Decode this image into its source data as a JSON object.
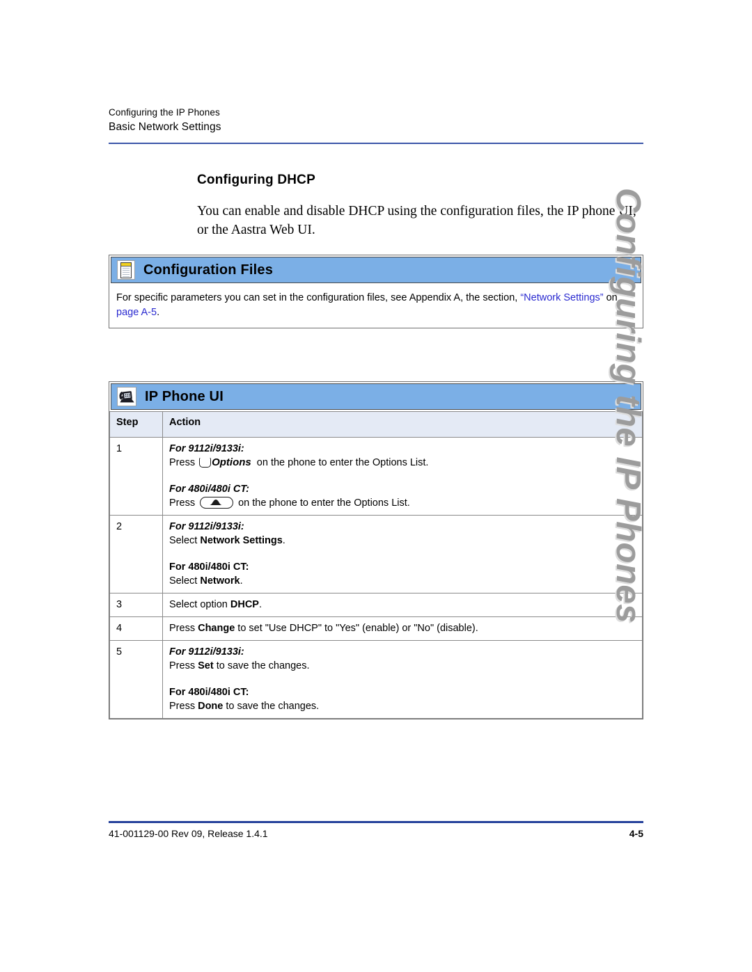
{
  "page": {
    "running_head_line1": "Configuring the IP Phones",
    "running_head_line2": "Basic Network Settings",
    "section_heading": "Configuring DHCP",
    "intro_paragraph": "You can enable and disable DHCP using the configuration files, the IP phone UI, or the Aastra Web UI.",
    "side_tab_text": "Configuring the IP Phones",
    "footer_left": "41-001129-00 Rev 09, Release 1.4.1",
    "footer_page": "4-5",
    "rule_color": "#3b55a8",
    "footer_rule_color": "#24409a",
    "side_tab_color": "#9c9c9c"
  },
  "config_files_box": {
    "icon": "notepad-icon",
    "title": "Configuration Files",
    "header_bg": "#7bafe6",
    "body_text_pre": "For specific parameters you can set in the configuration files, see Appendix A, the section, ",
    "link_open_quote": "“Network Settings”",
    "body_text_mid": " on ",
    "link_page": "page A-5",
    "body_text_end": ".",
    "link_color": "#2a2ad0"
  },
  "ip_phone_box": {
    "icon": "desk-phone-icon",
    "title": "IP Phone UI",
    "header_bg": "#7bafe6",
    "table": {
      "header_bg": "#e4eaf5",
      "columns": [
        "Step",
        "Action"
      ],
      "rows": [
        {
          "step": "1",
          "blocks": [
            {
              "label": "For 9112i/9133i:",
              "label_style": "bold-italic",
              "text_before_key": "Press ",
              "key": "options-key",
              "key_label": "Options",
              "text_after_key": " on the phone to enter the Options List."
            },
            {
              "label": "For 480i/480i CT:",
              "label_style": "bold-italic",
              "text_before_key": "Press ",
              "key": "oval-arrow-key",
              "key_label": "",
              "text_after_key": " on the phone to enter the Options List."
            }
          ]
        },
        {
          "step": "2",
          "blocks": [
            {
              "label": "For 9112i/9133i:",
              "label_style": "bold-italic",
              "text_before_key": "Select ",
              "key": "",
              "key_label": "Network Settings",
              "text_after_key": "."
            },
            {
              "label": "For 480i/480i CT:",
              "label_style": "bold",
              "text_before_key": "Select ",
              "key": "",
              "key_label": "Network",
              "text_after_key": "."
            }
          ]
        },
        {
          "step": "3",
          "blocks": [
            {
              "label": "",
              "label_style": "",
              "text_before_key": "Select option ",
              "key": "",
              "key_label": "DHCP",
              "text_after_key": "."
            }
          ]
        },
        {
          "step": "4",
          "blocks": [
            {
              "label": "",
              "label_style": "",
              "text_before_key": "Press ",
              "key": "",
              "key_label": "Change",
              "text_after_key": " to set \"Use DHCP\" to \"Yes\" (enable) or \"No\" (disable)."
            }
          ]
        },
        {
          "step": "5",
          "blocks": [
            {
              "label": "For 9112i/9133i:",
              "label_style": "bold-italic",
              "text_before_key": "Press ",
              "key": "",
              "key_label": "Set",
              "text_after_key": " to save the changes."
            },
            {
              "label": "For 480i/480i CT:",
              "label_style": "bold",
              "text_before_key": "Press ",
              "key": "",
              "key_label": "Done",
              "text_after_key": " to save the changes."
            }
          ]
        }
      ]
    }
  }
}
